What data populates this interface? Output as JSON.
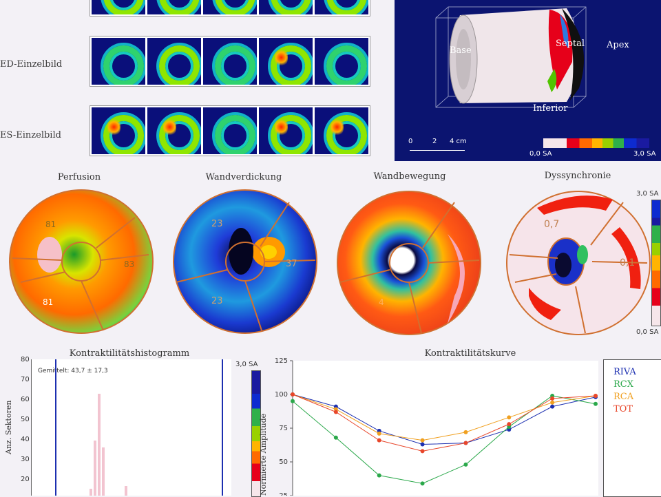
{
  "gated_strips": {
    "ed_label": "ED-Einzelbild",
    "es_label": "ES-Einzelbild"
  },
  "view_3d": {
    "labels": {
      "base": "Base",
      "septal": "Septal",
      "apex": "Apex",
      "inferior": "Inferior"
    },
    "scale": {
      "ticks": [
        "0",
        "2",
        "4 cm"
      ]
    },
    "colorbar": {
      "min": "0,0 SA",
      "max": "3,0 SA"
    },
    "colors": {
      "background": "#0b1470",
      "body": "#f0e6ea"
    }
  },
  "polar_maps": [
    {
      "title": "Perfusion",
      "values": [
        "81",
        "83",
        "81"
      ]
    },
    {
      "title": "Wandverdickung",
      "values": [
        "23",
        "37",
        "23"
      ]
    },
    {
      "title": "Wandbewegung",
      "values": [
        "4"
      ]
    },
    {
      "title": "Dyssynchronie",
      "values": [
        "0,7",
        "0,1"
      ]
    }
  ],
  "polar_legend": {
    "top": "3,0 SA",
    "bottom": "0,0 SA"
  },
  "histogram": {
    "title": "Kontraktilitätshistogramm",
    "ylabel": "Anz. Sektoren",
    "mean_text": "Gemittelt: 43,7 ± 17,3",
    "yticks": [
      "80",
      "70",
      "60",
      "50",
      "40",
      "30",
      "20"
    ],
    "colorbar_label": "3,0 SA"
  },
  "chart_data": {
    "type": "line",
    "title": "Kontraktilitätskurve",
    "ylabel": "Normierte Amplitude",
    "ylim": [
      25,
      125
    ],
    "yticks": [
      125,
      100,
      75,
      50,
      25
    ],
    "x": [
      1,
      2,
      3,
      4,
      5,
      6,
      7,
      8
    ],
    "series": [
      {
        "name": "RIVA",
        "color": "#1c2fb0",
        "values": [
          100,
          91,
          73,
          63,
          64,
          74,
          91,
          98
        ]
      },
      {
        "name": "RCX",
        "color": "#2aa84a",
        "values": [
          95,
          68,
          40,
          34,
          48,
          76,
          99,
          93
        ]
      },
      {
        "name": "RCA",
        "color": "#f0a020",
        "values": [
          100,
          89,
          71,
          66,
          72,
          83,
          94,
          99
        ]
      },
      {
        "name": "TOT",
        "color": "#e8462a",
        "values": [
          100,
          87,
          66,
          58,
          64,
          78,
          97,
          99
        ]
      }
    ]
  }
}
